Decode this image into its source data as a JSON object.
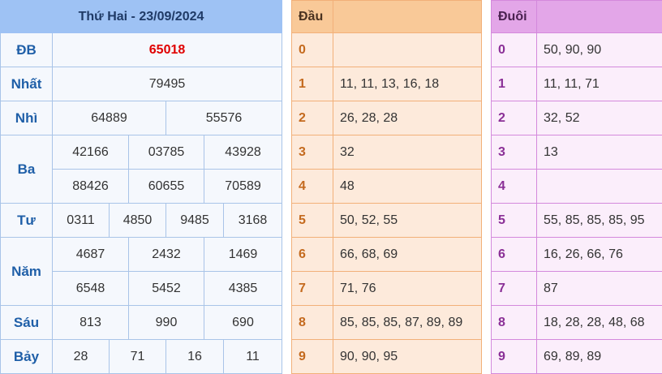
{
  "results": {
    "title": "Thứ Hai - 23/09/2024",
    "db": {
      "label": "ĐB",
      "value": "65018"
    },
    "nhat": {
      "label": "Nhất",
      "value": "79495"
    },
    "nhi": {
      "label": "Nhì",
      "values": [
        "64889",
        "55576"
      ]
    },
    "ba": {
      "label": "Ba",
      "values": [
        "42166",
        "03785",
        "43928",
        "88426",
        "60655",
        "70589"
      ]
    },
    "tu": {
      "label": "Tư",
      "values": [
        "0311",
        "4850",
        "9485",
        "3168"
      ]
    },
    "nam": {
      "label": "Năm",
      "values": [
        "4687",
        "2432",
        "1469",
        "6548",
        "5452",
        "4385"
      ]
    },
    "sau": {
      "label": "Sáu",
      "values": [
        "813",
        "990",
        "690"
      ]
    },
    "bay": {
      "label": "Bảy",
      "values": [
        "28",
        "71",
        "16",
        "11"
      ]
    }
  },
  "dau": {
    "header": "Đầu",
    "rows": [
      {
        "k": "0",
        "v": ""
      },
      {
        "k": "1",
        "v": "11, 11, 13, 16, 18"
      },
      {
        "k": "2",
        "v": "26, 28, 28"
      },
      {
        "k": "3",
        "v": "32"
      },
      {
        "k": "4",
        "v": "48"
      },
      {
        "k": "5",
        "v": "50, 52, 55"
      },
      {
        "k": "6",
        "v": "66, 68, 69"
      },
      {
        "k": "7",
        "v": "71, 76"
      },
      {
        "k": "8",
        "v": "85, 85, 85, 87, 89, 89"
      },
      {
        "k": "9",
        "v": "90, 90, 95"
      }
    ]
  },
  "duoi": {
    "header": "Đuôi",
    "rows": [
      {
        "k": "0",
        "v": "50, 90, 90"
      },
      {
        "k": "1",
        "v": "11, 11, 71"
      },
      {
        "k": "2",
        "v": "32, 52"
      },
      {
        "k": "3",
        "v": "13"
      },
      {
        "k": "4",
        "v": ""
      },
      {
        "k": "5",
        "v": "55, 85, 85, 85, 95"
      },
      {
        "k": "6",
        "v": "16, 26, 66, 76"
      },
      {
        "k": "7",
        "v": "87"
      },
      {
        "k": "8",
        "v": "18, 28, 28, 48, 68"
      },
      {
        "k": "9",
        "v": "69, 89, 89"
      }
    ]
  }
}
